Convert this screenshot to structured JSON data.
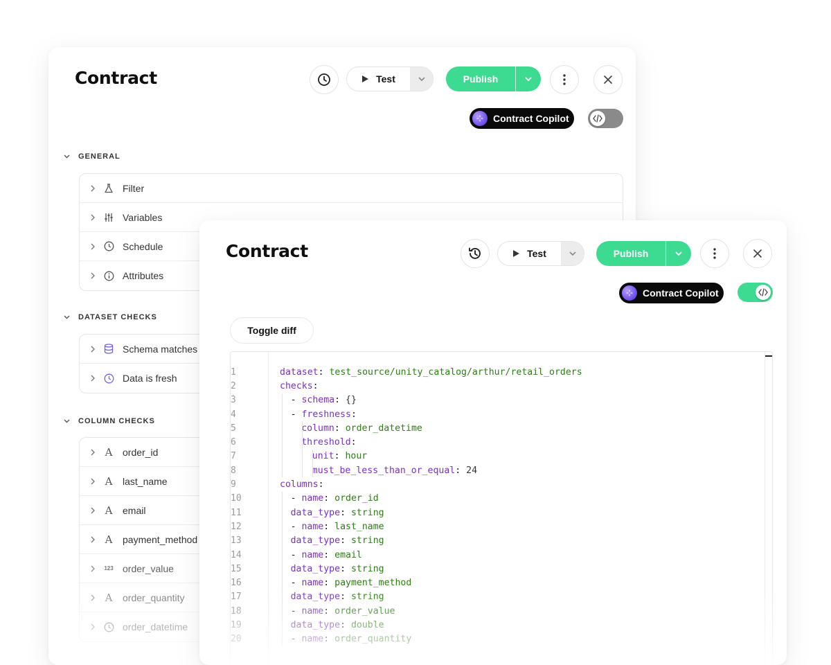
{
  "back_panel": {
    "title": "Contract",
    "toolbar": {
      "test_label": "Test",
      "publish_label": "Publish",
      "copilot_label": "Contract Copilot",
      "code_toggle_on": false
    },
    "sections": [
      {
        "title": "GENERAL",
        "items": [
          {
            "label": "Filter",
            "icon": "flask-icon"
          },
          {
            "label": "Variables",
            "icon": "sliders-icon"
          },
          {
            "label": "Schedule",
            "icon": "clock-icon"
          },
          {
            "label": "Attributes",
            "icon": "info-icon"
          }
        ]
      },
      {
        "title": "DATASET CHECKS",
        "items": [
          {
            "label": "Schema matches",
            "icon": "database-icon"
          },
          {
            "label": "Data is fresh",
            "icon": "clock-icon"
          }
        ]
      },
      {
        "title": "COLUMN CHECKS",
        "items": [
          {
            "label": "order_id",
            "icon": "text-type-icon"
          },
          {
            "label": "last_name",
            "icon": "text-type-icon"
          },
          {
            "label": "email",
            "icon": "text-type-icon"
          },
          {
            "label": "payment_method",
            "icon": "text-type-icon"
          },
          {
            "label": "order_value",
            "icon": "number-type-icon",
            "icon_text": "123"
          },
          {
            "label": "order_quantity",
            "icon": "text-type-icon"
          },
          {
            "label": "order_datetime",
            "icon": "clock-icon"
          }
        ]
      }
    ]
  },
  "front_panel": {
    "title": "Contract",
    "toolbar": {
      "test_label": "Test",
      "publish_label": "Publish",
      "copilot_label": "Contract Copilot",
      "code_toggle_on": true
    },
    "toggle_diff_label": "Toggle diff",
    "code_lines": [
      {
        "n": "1",
        "indent": 0,
        "key": "dataset",
        "value": "test_source/unity_catalog/arthur/retail_orders"
      },
      {
        "n": "2",
        "indent": 0,
        "key": "checks",
        "value": ""
      },
      {
        "n": "3",
        "indent": 1,
        "dash": true,
        "key": "schema",
        "value": "{}"
      },
      {
        "n": "4",
        "indent": 1,
        "dash": true,
        "key": "freshness",
        "value": ""
      },
      {
        "n": "5",
        "indent": 2,
        "key": "column",
        "value": "order_datetime"
      },
      {
        "n": "6",
        "indent": 2,
        "key": "threshold",
        "value": ""
      },
      {
        "n": "7",
        "indent": 3,
        "key": "unit",
        "value": "hour"
      },
      {
        "n": "8",
        "indent": 3,
        "key": "must_be_less_than_or_equal",
        "value": "24"
      },
      {
        "n": "9",
        "indent": 0,
        "key": "columns",
        "value": ""
      },
      {
        "n": "10",
        "indent": 1,
        "dash": true,
        "key": "name",
        "value": "order_id"
      },
      {
        "n": "11",
        "indent": 1,
        "key": "data_type",
        "value": "string"
      },
      {
        "n": "12",
        "indent": 1,
        "dash": true,
        "key": "name",
        "value": "last_name"
      },
      {
        "n": "13",
        "indent": 1,
        "key": "data_type",
        "value": "string"
      },
      {
        "n": "14",
        "indent": 1,
        "dash": true,
        "key": "name",
        "value": "email"
      },
      {
        "n": "15",
        "indent": 1,
        "key": "data_type",
        "value": "string"
      },
      {
        "n": "16",
        "indent": 1,
        "dash": true,
        "key": "name",
        "value": "payment_method"
      },
      {
        "n": "17",
        "indent": 1,
        "key": "data_type",
        "value": "string"
      },
      {
        "n": "18",
        "indent": 1,
        "dash": true,
        "key": "name",
        "value": "order_value"
      },
      {
        "n": "19",
        "indent": 1,
        "key": "data_type",
        "value": "double"
      },
      {
        "n": "20",
        "indent": 1,
        "dash": true,
        "key": "name",
        "value": "order_quantity"
      }
    ]
  },
  "colors": {
    "accent_green": "#3ddb92",
    "yaml_key": "#7b2fc7",
    "yaml_value": "#2e7d16",
    "icon_purple": "#7a5cf0",
    "toggle_off": "#8a8a8a"
  }
}
